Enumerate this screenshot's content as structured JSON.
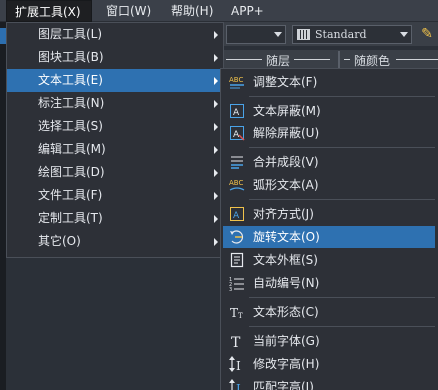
{
  "menubar": {
    "items": [
      {
        "label": "扩展工具(X)",
        "active": true
      },
      {
        "label": "窗口(W)"
      },
      {
        "label": "帮助(H)"
      },
      {
        "label": "APP+"
      }
    ]
  },
  "toolbar": {
    "text_style_value": "Standard",
    "layer_line_value": "随层",
    "color_value": "随颜色"
  },
  "main_menu": {
    "items": [
      {
        "label": "图层工具(L)"
      },
      {
        "label": "图块工具(B)"
      },
      {
        "label": "文本工具(E)"
      },
      {
        "label": "标注工具(N)"
      },
      {
        "label": "选择工具(S)"
      },
      {
        "label": "编辑工具(M)"
      },
      {
        "label": "绘图工具(D)"
      },
      {
        "label": "文件工具(F)"
      },
      {
        "label": "定制工具(T)"
      },
      {
        "label": "其它(O)"
      }
    ]
  },
  "submenu": {
    "items": [
      {
        "label": "调整文本(F)",
        "icon": "abc-adjust-icon"
      },
      {
        "label": "文本屏蔽(M)",
        "icon": "text-mask-icon"
      },
      {
        "label": "解除屏蔽(U)",
        "icon": "unmask-icon"
      },
      {
        "label": "合并成段(V)",
        "icon": "merge-paragraph-icon"
      },
      {
        "label": "弧形文本(A)",
        "icon": "arc-text-icon"
      },
      {
        "label": "对齐方式(J)",
        "icon": "justify-icon"
      },
      {
        "label": "旋转文本(O)",
        "icon": "rotate-text-icon"
      },
      {
        "label": "文本外框(S)",
        "icon": "text-frame-icon"
      },
      {
        "label": "自动编号(N)",
        "icon": "auto-number-icon"
      },
      {
        "label": "文本形态(C)",
        "icon": "text-form-icon"
      },
      {
        "label": "当前字体(G)",
        "icon": "current-font-icon"
      },
      {
        "label": "修改字高(H)",
        "icon": "change-height-icon"
      },
      {
        "label": "匹配字高(I)",
        "icon": "match-height-icon"
      }
    ]
  },
  "colors": {
    "highlight": "#2e71b1",
    "menu_bg": "#2d3037",
    "menubar_bg": "#3b4049",
    "icon_blue": "#4aa3e8",
    "icon_yellow": "#f0c24b"
  }
}
